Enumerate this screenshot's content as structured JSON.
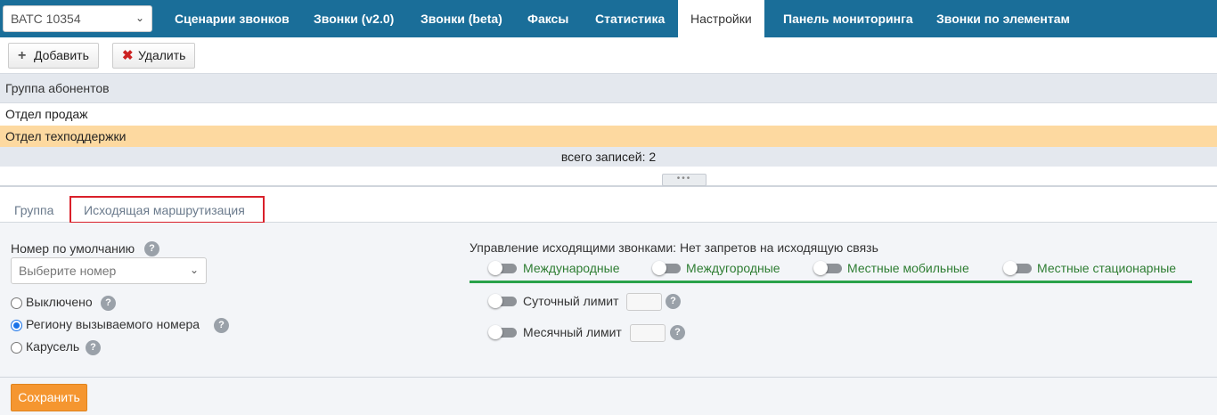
{
  "header": {
    "pbx_select": "ВАТС 10354",
    "tabs": [
      {
        "label": "Сценарии звонков"
      },
      {
        "label": "Звонки (v2.0)"
      },
      {
        "label": "Звонки (beta)"
      },
      {
        "label": "Факсы"
      },
      {
        "label": "Статистика"
      },
      {
        "label": "Настройки",
        "active": true
      },
      {
        "label": "Панель мониторинга"
      },
      {
        "label": "Звонки по элементам"
      }
    ]
  },
  "toolbar": {
    "add_label": "Добавить",
    "add_icon": "plus-icon",
    "delete_label": "Удалить",
    "delete_icon": "close-icon"
  },
  "grid": {
    "column_header": "Группа абонентов",
    "rows": [
      {
        "name": "Отдел продаж",
        "selected": false
      },
      {
        "name": "Отдел техподдержки",
        "selected": true
      }
    ],
    "footer": "всего записей: 2"
  },
  "subtabs": [
    {
      "label": "Группа",
      "active": false
    },
    {
      "label": "Исходящая маршрутизация",
      "active": true
    }
  ],
  "routing": {
    "default_number_label": "Номер по умолчанию",
    "default_number_placeholder": "Выберите номер",
    "radios": [
      {
        "label": "Выключено",
        "checked": false
      },
      {
        "label": "Региону вызываемого номера",
        "checked": true
      },
      {
        "label": "Карусель",
        "checked": false
      }
    ],
    "outgoing_title": "Управление исходящими звонками: Нет запретов на исходящую связь",
    "call_types": [
      {
        "label": "Международные",
        "on": false
      },
      {
        "label": "Междугородные",
        "on": false
      },
      {
        "label": "Местные мобильные",
        "on": false
      },
      {
        "label": "Местные стационарные",
        "on": false
      }
    ],
    "daily_limit_label": "Суточный лимит",
    "monthly_limit_label": "Месячный лимит"
  },
  "save_label": "Сохранить",
  "colors": {
    "nav_bg": "#1a6e99",
    "selected_row": "#fdd9a0",
    "accent_green": "#2aa24a",
    "save_button": "#f59630",
    "highlight_border": "#d9202a"
  }
}
